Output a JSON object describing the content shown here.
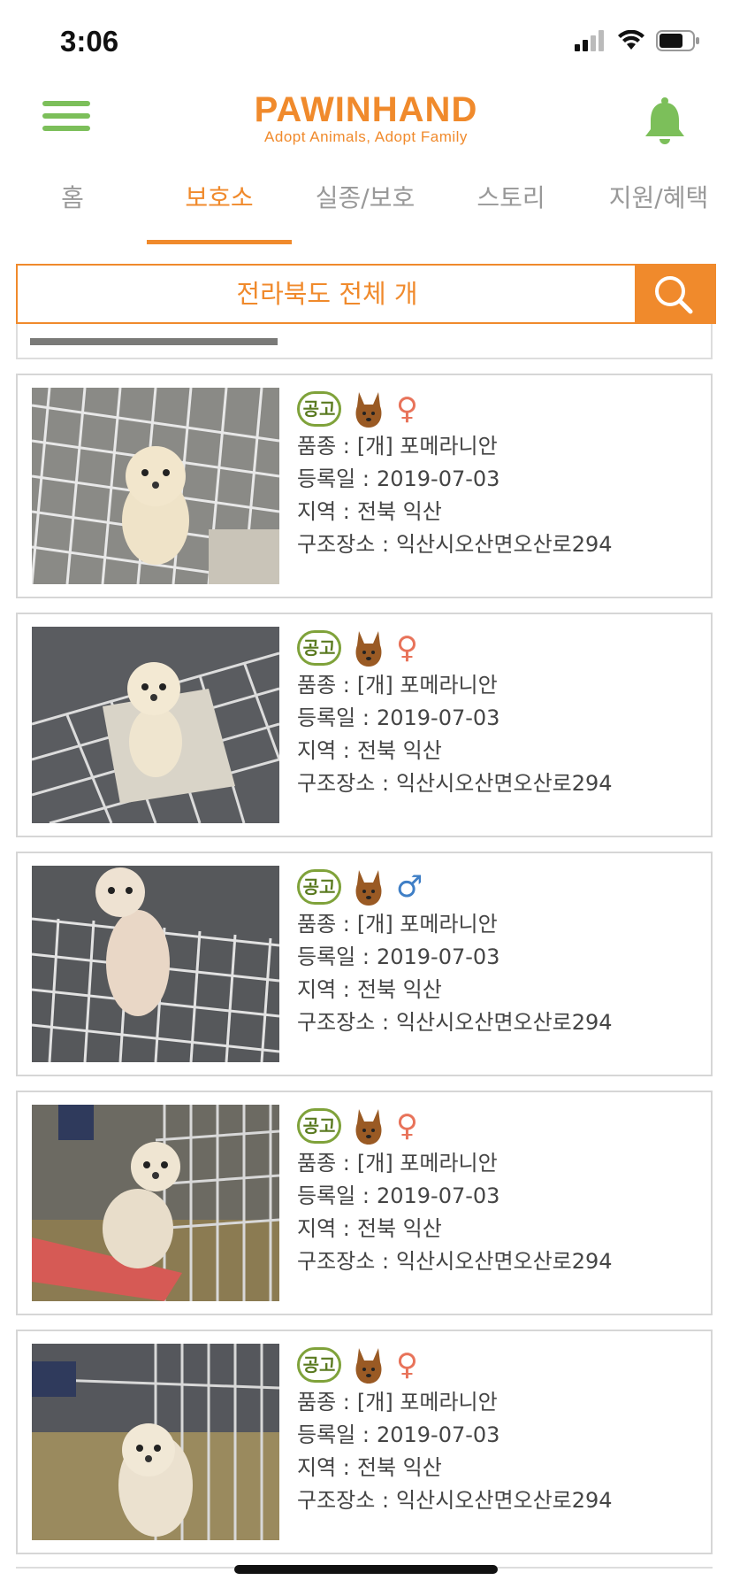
{
  "status_bar": {
    "time": "3:06"
  },
  "header": {
    "app_name": "PAWINHAND",
    "tagline": "Adopt Animals, Adopt Family"
  },
  "tabs": [
    {
      "label": "홈",
      "active": false
    },
    {
      "label": "보호소",
      "active": true
    },
    {
      "label": "실종/보호",
      "active": false
    },
    {
      "label": "스토리",
      "active": false
    },
    {
      "label": "지원/혜택",
      "active": false
    }
  ],
  "search": {
    "query": "전라북도 전체  개"
  },
  "field_labels": {
    "breed": "품종 :",
    "date": "등록일 :",
    "region": "지역 :",
    "place": "구조장소 :"
  },
  "badge_text": "공고",
  "listings": [
    {
      "breed": "[개] 포메라니안",
      "date": "2019-07-03",
      "region": "전북 익산",
      "place": "익산시오산면오산로294",
      "sex": "♀"
    },
    {
      "breed": "[개] 포메라니안",
      "date": "2019-07-03",
      "region": "전북 익산",
      "place": "익산시오산면오산로294",
      "sex": "♀"
    },
    {
      "breed": "[개] 포메라니안",
      "date": "2019-07-03",
      "region": "전북 익산",
      "place": "익산시오산면오산로294",
      "sex": "♂"
    },
    {
      "breed": "[개] 포메라니안",
      "date": "2019-07-03",
      "region": "전북 익산",
      "place": "익산시오산면오산로294",
      "sex": "♀"
    },
    {
      "breed": "[개] 포메라니안",
      "date": "2019-07-03",
      "region": "전북 익산",
      "place": "익산시오산면오산로294",
      "sex": "♀"
    }
  ],
  "colors": {
    "accent": "#f08a2c",
    "green": "#7cbf5a",
    "female": "#e8735a",
    "male": "#3f7fc6"
  }
}
